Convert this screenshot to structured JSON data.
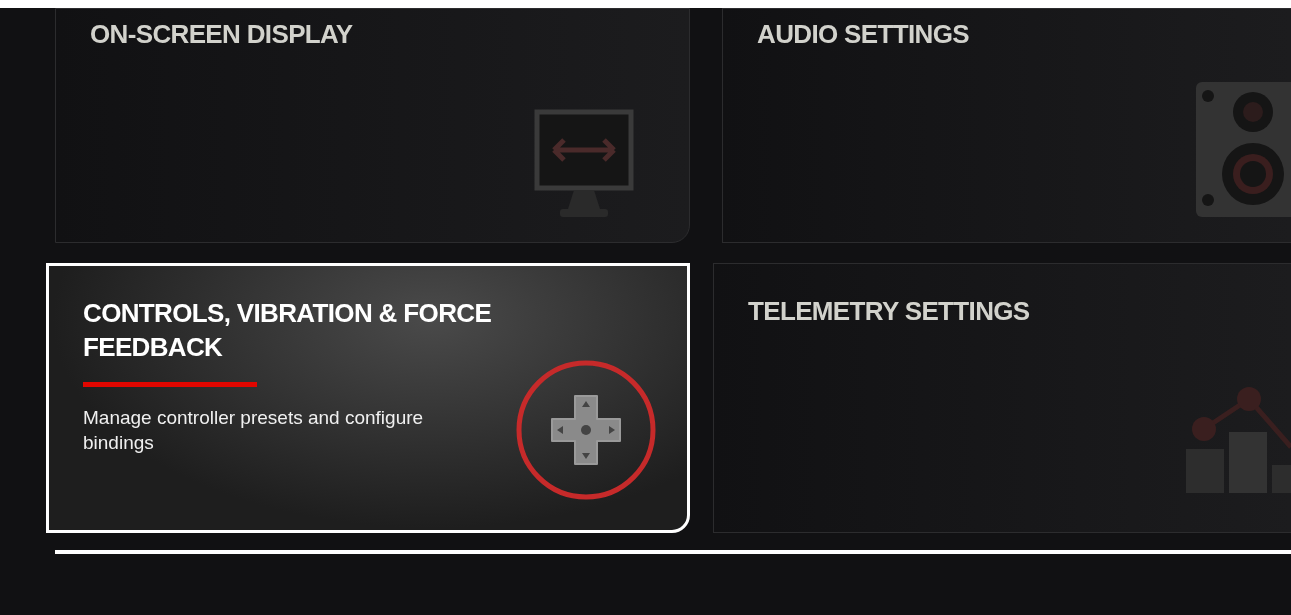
{
  "tiles": [
    {
      "title": "ON-SCREEN DISPLAY",
      "selected": false,
      "kind": "monitor"
    },
    {
      "title": "AUDIO SETTINGS",
      "selected": false,
      "kind": "speaker"
    },
    {
      "title": "CONTROLS, VIBRATION & FORCE FEEDBACK",
      "selected": true,
      "description": "Manage controller presets and configure bindings",
      "kind": "dpad"
    },
    {
      "title": "TELEMETRY SETTINGS",
      "selected": false,
      "kind": "chart"
    }
  ]
}
